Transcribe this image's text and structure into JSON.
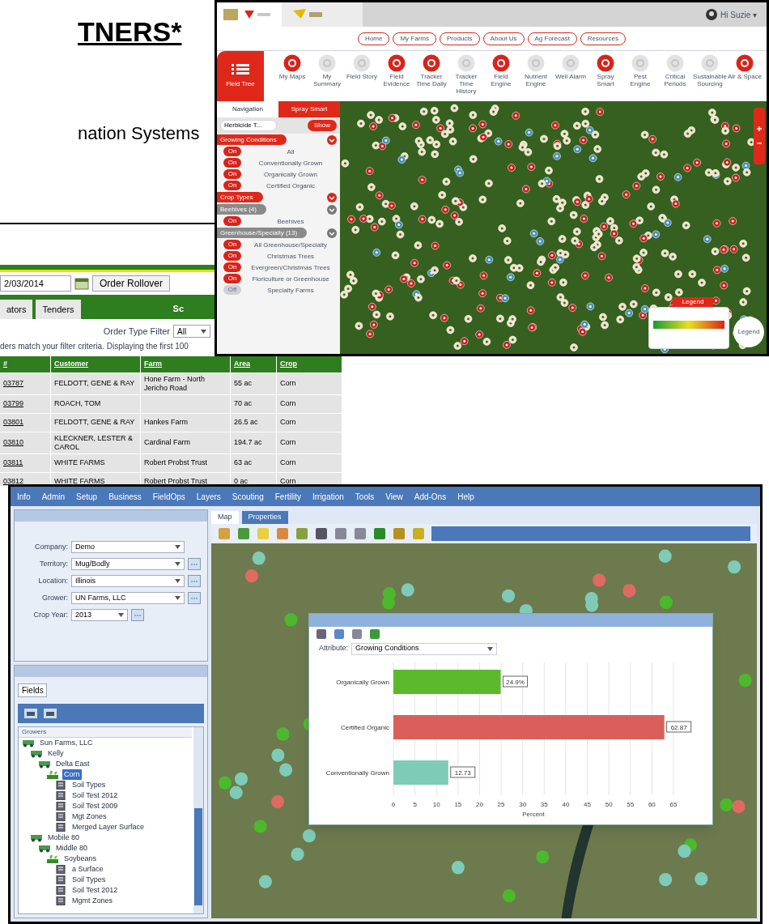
{
  "slide": {
    "title": "TNERS*",
    "subtitle": "nation Systems"
  },
  "portal": {
    "user": "Hi Suzie ▾",
    "nav": [
      "Home",
      "My Farms",
      "Products",
      "About Us",
      "Ag Forecast",
      "Resources"
    ],
    "field_tree": "Field Tree",
    "tools": [
      {
        "label": "My Maps",
        "on": true
      },
      {
        "label": "My Summary",
        "on": false
      },
      {
        "label": "Field Story",
        "on": false
      },
      {
        "label": "Field Evidence",
        "on": true
      },
      {
        "label": "Tracker Time Daily",
        "on": true
      },
      {
        "label": "Tracker Time History",
        "on": false
      },
      {
        "label": "Field Engine",
        "on": true
      },
      {
        "label": "Nutrient Engine",
        "on": false
      },
      {
        "label": "Well Alarm",
        "on": false
      },
      {
        "label": "Spray Smart",
        "on": true
      },
      {
        "label": "Pest Engine",
        "on": false
      },
      {
        "label": "Critical Periods",
        "on": false
      },
      {
        "label": "Sustainable Sourcing",
        "on": false
      },
      {
        "label": "Air & Space",
        "on": true
      }
    ],
    "tabs": [
      {
        "label": "Navigation",
        "selected": true
      },
      {
        "label": "Spray Smart",
        "selected": false
      }
    ],
    "search": {
      "value": "Herbicide T...",
      "button": "Show"
    },
    "sections": [
      {
        "title": "Growing Conditions",
        "major": true,
        "rows": [
          {
            "label": "All",
            "toggle": "On",
            "on": true
          },
          {
            "label": "Conventionally Grown",
            "toggle": "On",
            "on": true
          },
          {
            "label": "Organically Grown",
            "toggle": "On",
            "on": true
          },
          {
            "label": "Certified Organic",
            "toggle": "On",
            "on": true
          }
        ]
      },
      {
        "title": "Crop Types",
        "major": true
      },
      {
        "title": "Beehives (4)",
        "major": false,
        "rows": [
          {
            "label": "Beehives",
            "toggle": "On",
            "on": true
          }
        ]
      },
      {
        "title": "Greenhouse/Specialty (13)",
        "major": false,
        "rows": [
          {
            "label": "All Greenhouse/Specialty",
            "toggle": "On",
            "on": true
          },
          {
            "label": "Christmas Trees",
            "toggle": "On",
            "on": true
          },
          {
            "label": "Evergreen/Christmas Trees",
            "toggle": "On",
            "on": true
          },
          {
            "label": "Floriculture or Greenhouse",
            "toggle": "On",
            "on": true
          },
          {
            "label": "Specialty Farms",
            "toggle": "Off",
            "on": false
          }
        ]
      }
    ],
    "legend_title": "Legend",
    "legend_button": "Legend"
  },
  "orders": {
    "date": "2/03/2014",
    "rollover": "Order Rollover",
    "tabs": [
      {
        "label": "ators",
        "selected": false
      },
      {
        "label": "Tenders",
        "selected": false
      }
    ],
    "tab_right": "Sc",
    "filter_label": "Order Type Filter",
    "filter_value": "All",
    "message": "ders match your filter criteria.  Displaying the first 100",
    "columns": [
      "#",
      "Customer",
      "Farm",
      "Area",
      "Crop"
    ],
    "rows": [
      [
        "03787",
        "FELDOTT, GENE & RAY",
        "Hone Farm - North Jericho Road",
        "55 ac",
        "Corn"
      ],
      [
        "03799",
        "ROACH, TOM",
        "",
        "70 ac",
        "Corn"
      ],
      [
        "03801",
        "FELDOTT, GENE & RAY",
        "Hankes Farm",
        "26.5 ac",
        "Corn"
      ],
      [
        "03810",
        "KLECKNER, LESTER & CAROL",
        "Cardinal Farm",
        "194.7 ac",
        "Corn"
      ],
      [
        "03811",
        "WHITE FARMS",
        "Robert Probst Trust",
        "63 ac",
        "Corn"
      ],
      [
        "03812",
        "WHITE FARMS",
        "Robert Probst Trust",
        "0 ac",
        "Corn"
      ]
    ]
  },
  "gis": {
    "menu": [
      "Info",
      "Admin",
      "Setup",
      "Business",
      "FieldOps",
      "Layers",
      "Scouting",
      "Fertility",
      "Irrigation",
      "Tools",
      "View",
      "Add-Ons",
      "Help"
    ],
    "form": [
      {
        "label": "Company:",
        "value": "Demo",
        "lookup": false
      },
      {
        "label": "Territory:",
        "value": "Mug/Bodly",
        "lookup": true
      },
      {
        "label": "Location:",
        "value": "Illinois",
        "lookup": true
      },
      {
        "label": "Grower:",
        "value": "UN Farms, LLC",
        "lookup": true
      },
      {
        "label": "Crop Year:",
        "value": "2013",
        "lookup": true
      }
    ],
    "fields_tab": "Fields",
    "tree_header": "Growers",
    "tree": [
      {
        "label": "Sun Farms, LLC",
        "selected": false,
        "kind": "farm",
        "children": [
          {
            "label": "Kelly",
            "selected": false,
            "kind": "farm",
            "children": [
              {
                "label": "Delta East",
                "selected": false,
                "kind": "farm",
                "children": [
                  {
                    "label": "Corn",
                    "selected": true,
                    "kind": "crop",
                    "children": [
                      {
                        "label": "Soil Types",
                        "selected": false,
                        "kind": "layer"
                      },
                      {
                        "label": "Soil Test 2012",
                        "selected": false,
                        "kind": "layer"
                      },
                      {
                        "label": "Soil Test 2009",
                        "selected": false,
                        "kind": "layer"
                      },
                      {
                        "label": "Mgt Zones",
                        "selected": false,
                        "kind": "layer"
                      },
                      {
                        "label": "Merged Layer Surface",
                        "selected": false,
                        "kind": "layer"
                      }
                    ]
                  }
                ]
              }
            ]
          },
          {
            "label": "Mobile 80",
            "selected": false,
            "kind": "farm",
            "children": [
              {
                "label": "Middle 80",
                "selected": false,
                "kind": "farm",
                "children": [
                  {
                    "label": "Soybeans",
                    "selected": false,
                    "kind": "crop",
                    "children": [
                      {
                        "label": "a Surface",
                        "selected": false,
                        "kind": "layer"
                      },
                      {
                        "label": "Soil Types",
                        "selected": false,
                        "kind": "layer"
                      },
                      {
                        "label": "Soil Test 2012",
                        "selected": false,
                        "kind": "layer"
                      },
                      {
                        "label": "Mgmt Zones",
                        "selected": false,
                        "kind": "layer"
                      }
                    ]
                  }
                ]
              }
            ]
          }
        ]
      }
    ],
    "map_tabs": [
      {
        "label": "Map",
        "selected": false
      },
      {
        "label": "Properties",
        "selected": true
      }
    ],
    "dialog": {
      "attribute_label": "Attribute:",
      "attribute_value": "Growing Conditions",
      "chart_data": {
        "type": "bar",
        "orientation": "horizontal",
        "xlabel": "Percent",
        "grid": true,
        "categories": [
          "Organically Grown",
          "Certified Organic",
          "Conventionally Grown"
        ],
        "values": [
          24.9,
          62.87,
          12.73
        ],
        "colors": [
          "#5cb82c",
          "#d9605a",
          "#7ecbb8"
        ],
        "value_labels": [
          "24.9%",
          "62.87",
          "12.73"
        ],
        "xlim": [
          0,
          65
        ],
        "xticks": [
          0,
          5,
          10,
          15,
          20,
          25,
          30,
          35,
          40,
          45,
          50,
          55,
          60,
          65
        ]
      }
    }
  }
}
